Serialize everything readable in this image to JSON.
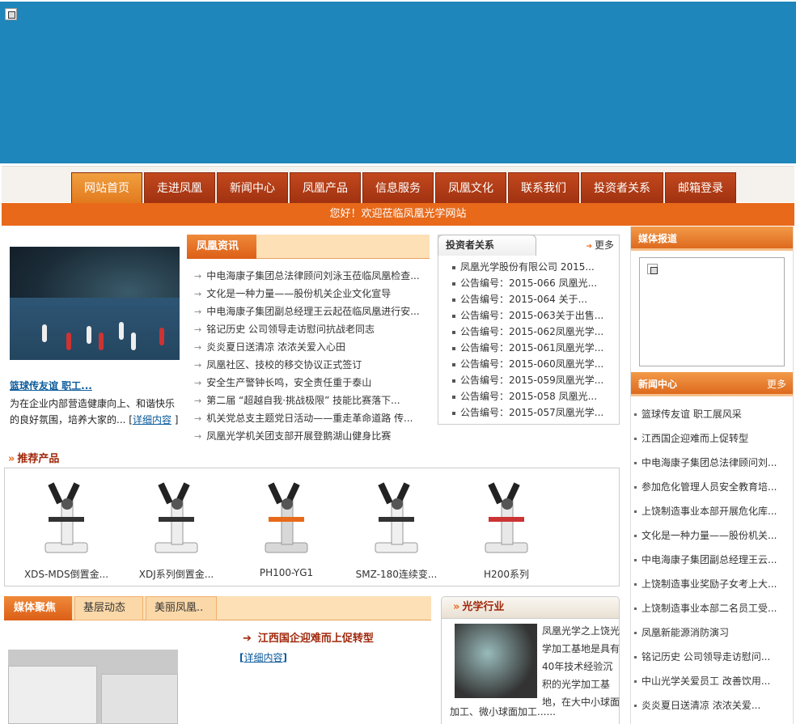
{
  "nav": {
    "items": [
      "网站首页",
      "走进凤凰",
      "新闻中心",
      "凤凰产品",
      "信息服务",
      "凤凰文化",
      "联系我们",
      "投资者关系",
      "邮箱登录"
    ],
    "active": "网站首页"
  },
  "welcome": "您好！欢迎莅临凤凰光学网站",
  "feature": {
    "title": "篮球传友谊 职工...",
    "desc": "为在企业内部营造健康向上、和谐快乐的良好氛围，培养大家的... [",
    "more": "详细内容",
    "close": "]"
  },
  "phoenix_news": {
    "tab": "凤凰资讯",
    "items": [
      "中电海康子集团总法律顾问刘泳玉莅临凤凰检查...",
      "文化是一种力量——股份机关企业文化宣导",
      "中电海康子集团副总经理王云起莅临凤凰进行安...",
      "铭记历史 公司领导走访慰问抗战老同志",
      "炎炎夏日送清凉 浓浓关爱入心田",
      "凤凰社区、技校的移交协议正式签订",
      "安全生产警钟长鸣，安全责任重于泰山",
      "第二届 “超越自我·挑战极限” 技能比赛落下...",
      "机关党总支主题党日活动——重走革命道路 传...",
      "凤凰光学机关团支部开展登鹅湖山健身比赛"
    ]
  },
  "investor": {
    "tab": "投资者关系",
    "more": "更多",
    "items": [
      "凤凰光学股份有限公司 2015...",
      "公告编号：2015-066 凤凰光...",
      "公告编号：2015-064 关于...",
      "公告编号：2015-063关于出售...",
      "公告编号：2015-062凤凰光学...",
      "公告编号：2015-061凤凰光学...",
      "公告编号：2015-060凤凰光学...",
      "公告编号：2015-059凤凰光学...",
      "公告编号：2015-058 凤凰光...",
      "公告编号：2015-057凤凰光学..."
    ]
  },
  "media_report": {
    "title": "媒体报道"
  },
  "news_center": {
    "title": "新闻中心",
    "more": "更多",
    "items": [
      "篮球传友谊 职工展风采",
      "江西国企迎难而上促转型",
      "中电海康子集团总法律顾问刘...",
      "参加危化管理人员安全教育培...",
      "上饶制造事业本部开展危化库...",
      "文化是一种力量——股份机关...",
      "中电海康子集团副总经理王云...",
      "上饶制造事业奖励子女考上大...",
      "上饶制造事业本部二名员工受...",
      "凤凰新能源消防演习",
      "铭记历史 公司领导走访慰问...",
      "中山光学关爱员工 改善饮用...",
      "炎炎夏日送清凉 浓浓关爱..."
    ]
  },
  "products": {
    "title": "推荐产品",
    "items": [
      "XDS-MDS倒置金...",
      "XDJ系列倒置金...",
      "PH100-YG1",
      "SMZ-180连续变...",
      "H200系列"
    ]
  },
  "media_focus": {
    "tabs": [
      "媒体聚焦",
      "基层动态",
      "美丽凤凰.."
    ],
    "headline": "江西国企迎难而上促转型",
    "more_open": "[",
    "more": "详细内容",
    "more_close": "]"
  },
  "optics": {
    "title": "光学行业",
    "text": "凤凰光学之上饶光学加工基地是具有40年技术经验沉积的光学加工基地，在大中小球面",
    "text2": "加工、微小球面加工......"
  },
  "colors": {
    "banner": "#1e86ba",
    "orange": "#e8691a",
    "nav_red": "#b23c15"
  }
}
